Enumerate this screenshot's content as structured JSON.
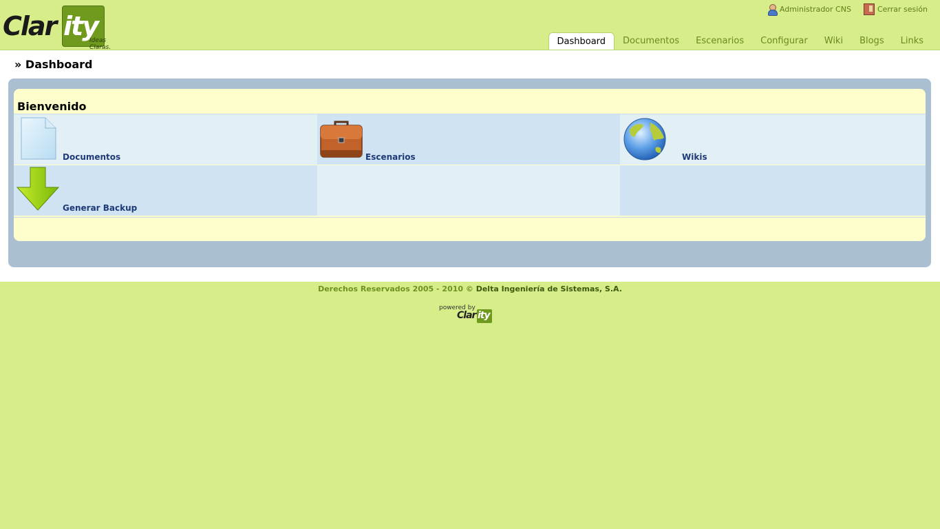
{
  "brand": {
    "logo_text": "Clarity",
    "logo_left": "Clar",
    "logo_right": "ity",
    "tagline": "Ideas Claras."
  },
  "userbar": {
    "user_label": "Administrador CNS",
    "logout_label": "Cerrar sesión"
  },
  "tabs": [
    {
      "label": "Dashboard",
      "active": true
    },
    {
      "label": "Documentos",
      "active": false
    },
    {
      "label": "Escenarios",
      "active": false
    },
    {
      "label": "Configurar",
      "active": false
    },
    {
      "label": "Wiki",
      "active": false
    },
    {
      "label": "Blogs",
      "active": false
    },
    {
      "label": "Links",
      "active": false
    }
  ],
  "breadcrumb": "» Dashboard",
  "panel": {
    "title": "Bienvenido",
    "items": [
      {
        "label": "Documentos",
        "icon": "document-icon"
      },
      {
        "label": "Escenarios",
        "icon": "briefcase-icon"
      },
      {
        "label": "Wikis",
        "icon": "globe-icon"
      },
      {
        "label": "Generar Backup",
        "icon": "download-arrow-icon"
      }
    ]
  },
  "footer": {
    "copyright_prefix": "Derechos Reservados 2005 - 2010 © ",
    "copyright_brand": "Delta Ingeniería de Sistemas, S.A.",
    "powered_by": "powered by",
    "powered_left": "Clar",
    "powered_right": "ity"
  },
  "colors": {
    "background": "#d6ed8a",
    "accent": "#6f9a1e",
    "panel_frame": "#aac0d2",
    "panel_bg": "#fefecc",
    "link": "#1f3a78"
  }
}
